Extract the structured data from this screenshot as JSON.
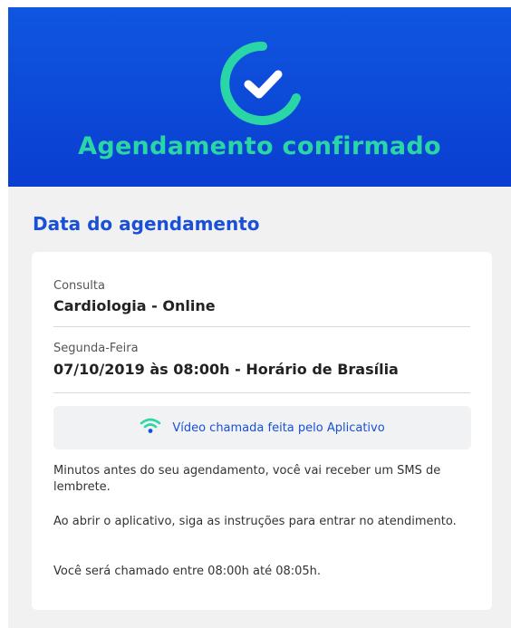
{
  "header": {
    "title": "Agendamento confirmado",
    "icon": "check-circle-icon",
    "colors": {
      "background": "#0a3ed0",
      "accent": "#2ad6a6"
    }
  },
  "section": {
    "title": "Data do agendamento"
  },
  "appointment": {
    "consult_label": "Consulta",
    "consult_value": "Cardiologia - Online",
    "day_label": "Segunda-Feira",
    "datetime_value": "07/10/2019 às 08:00h - Horário de Brasília",
    "video_icon": "wifi-icon",
    "video_text": "Vídeo chamada feita pelo Aplicativo",
    "info": [
      "Minutos antes do seu agendamento, você vai receber um SMS de lembrete.",
      "Ao abrir o aplicativo, siga as instruções para entrar no atendimento.",
      "Você será chamado entre 08:00h até 08:05h."
    ]
  }
}
